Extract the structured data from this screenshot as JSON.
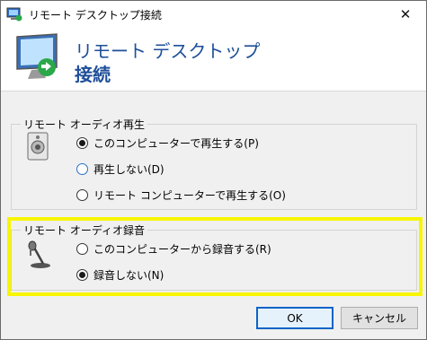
{
  "window": {
    "title": "リモート デスクトップ接続"
  },
  "banner": {
    "line1": "リモート デスクトップ",
    "line2": "接続"
  },
  "playback": {
    "legend": "リモート オーディオ再生",
    "options": [
      {
        "label": "このコンピューターで再生する(P)",
        "selected": true
      },
      {
        "label": "再生しない(D)",
        "selected": false
      },
      {
        "label": "リモート コンピューターで再生する(O)",
        "selected": false
      }
    ]
  },
  "recording": {
    "legend": "リモート オーディオ録音",
    "options": [
      {
        "label": "このコンピューターから録音する(R)",
        "selected": false
      },
      {
        "label": "録音しない(N)",
        "selected": true
      }
    ]
  },
  "buttons": {
    "ok": "OK",
    "cancel": "キャンセル"
  },
  "icons": {
    "app": "remote-desktop-icon",
    "close": "close-icon",
    "speaker": "speaker-icon",
    "microphone": "microphone-icon"
  },
  "colors": {
    "banner_text": "#1e4e99",
    "highlight": "#f7f500",
    "default_button_border": "#0a64c8"
  }
}
